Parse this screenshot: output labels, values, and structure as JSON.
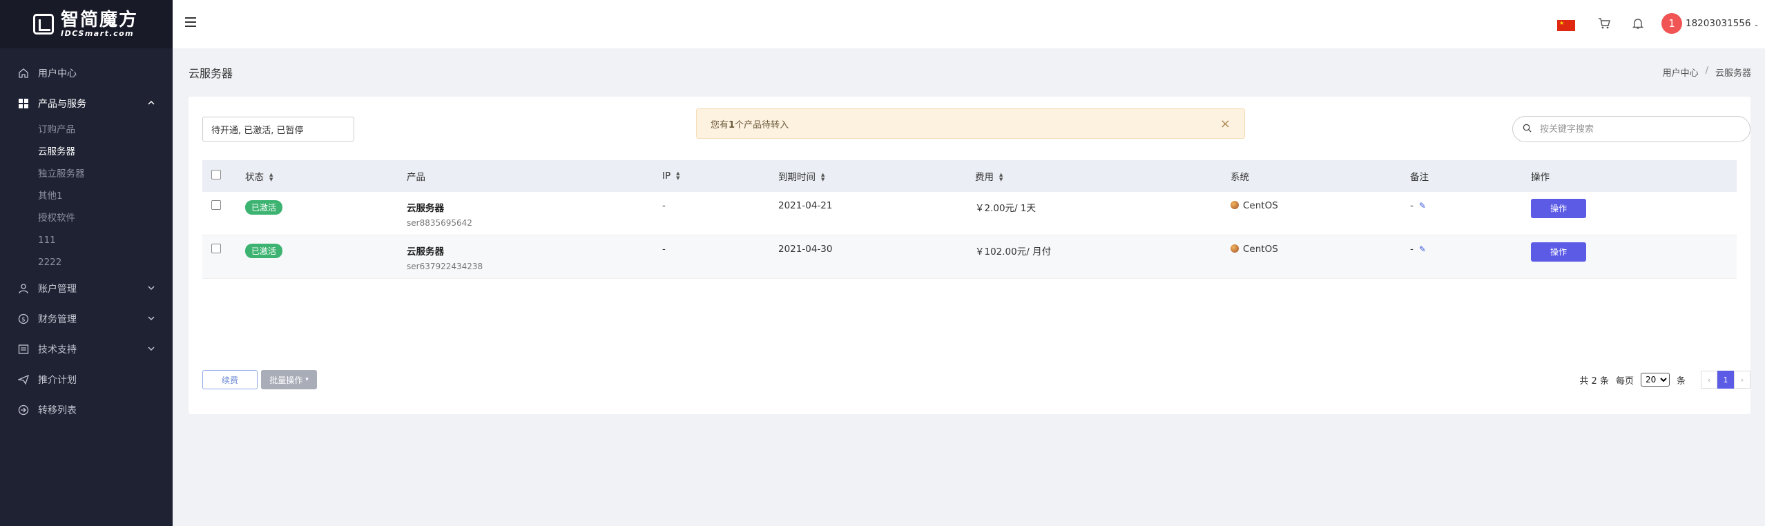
{
  "brand": {
    "name_cn": "智简魔方",
    "name_en": "IDCSmart.com"
  },
  "sidebar": {
    "items": [
      {
        "label": "用户中心",
        "icon": "home-icon"
      },
      {
        "label": "产品与服务",
        "icon": "grid-icon",
        "open": true,
        "children": [
          "订购产品",
          "云服务器",
          "独立服务器",
          "其他1",
          "授权软件",
          "111",
          "2222"
        ],
        "active_child": "云服务器"
      },
      {
        "label": "账户管理",
        "icon": "user-icon"
      },
      {
        "label": "财务管理",
        "icon": "dollar-icon"
      },
      {
        "label": "技术支持",
        "icon": "list-icon"
      },
      {
        "label": "推介计划",
        "icon": "paper-plane-icon"
      },
      {
        "label": "转移列表",
        "icon": "transfer-icon"
      }
    ]
  },
  "header": {
    "username": "18203031556",
    "avatar_text": "1"
  },
  "page": {
    "title": "云服务器",
    "breadcrumb": [
      "用户中心",
      "云服务器"
    ]
  },
  "filters": {
    "status_value": "待开通, 已激活, 已暂停",
    "search_placeholder": "按关键字搜索"
  },
  "alert": {
    "text_prefix": "您有",
    "count": "1",
    "text_suffix": "个产品待转入"
  },
  "table": {
    "headers": {
      "status": "状态",
      "product": "产品",
      "ip": "IP",
      "due": "到期时间",
      "fee": "费用",
      "os": "系统",
      "note": "备注",
      "action": "操作"
    },
    "rows": [
      {
        "status": "已激活",
        "product": "云服务器",
        "code": "ser8835695642",
        "ip": "-",
        "due": "2021-04-21",
        "fee": "￥2.00元/ 1天",
        "os": "CentOS",
        "note": "-",
        "action": "操作"
      },
      {
        "status": "已激活",
        "product": "云服务器",
        "code": "ser637922434238",
        "ip": "-",
        "due": "2021-04-30",
        "fee": "￥102.00元/ 月付",
        "os": "CentOS",
        "note": "-",
        "action": "操作"
      }
    ]
  },
  "footer": {
    "renew_label": "续费",
    "batch_label": "批量操作",
    "total_text": "共 2 条",
    "per_page_label": "每页",
    "per_page_value": "20",
    "per_page_unit": "条",
    "prev": "‹",
    "current_page": "1",
    "next": "›"
  },
  "colors": {
    "sidebar_bg": "#1f2233",
    "accent": "#5b5be6",
    "active_badge": "#3cb371",
    "avatar": "#f05454"
  }
}
